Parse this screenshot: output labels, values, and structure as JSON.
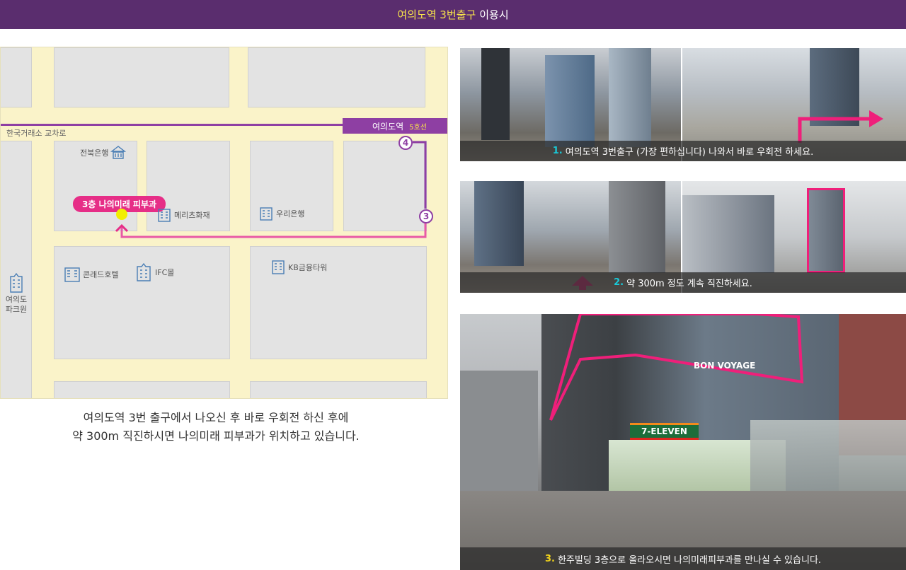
{
  "header": {
    "highlight": "여의도역 3번출구",
    "rest": "이용시"
  },
  "map": {
    "road": "한국거래소 교차로",
    "station_name": "여의도역",
    "station_line": "5호선",
    "exit_4": "4",
    "exit_3": "3",
    "clinic": "3층 나의미래 피부과",
    "places": {
      "jeonbuk": "전북은행",
      "meritz": "메리츠화재",
      "woori": "우리은행",
      "conrad": "콘래드호텔",
      "ifc": "IFC몰",
      "kb": "KB금융타워",
      "park_line1": "여의도",
      "park_line2": "파크원"
    }
  },
  "description": {
    "line1": "여의도역 3번 출구에서 나오신 후 바로 우회전 하신 후에",
    "line2": "약 300m 직진하시면 나의미래 피부과가 위치하고 있습니다."
  },
  "steps": [
    {
      "num": "1.",
      "text": "여의도역 3번출구 (가장 편하십니다) 나와서 바로 우회전 하세요."
    },
    {
      "num": "2.",
      "text": "약 300m 정도 계속 직진하세요."
    },
    {
      "num": "3.",
      "text": "한주빌딩 3층으로 올라오시면 나의미래피부과를 만나실 수 있습니다."
    }
  ],
  "photo3_signs": {
    "store": "7-ELEVEN",
    "voyage": "BON VOYAGE"
  },
  "colors": {
    "header_bg": "#5a2d6e",
    "highlight": "#f7e34a",
    "station": "#8e3fa3",
    "route": "#e85aa6",
    "clinic": "#e62e87",
    "step_num": "#19c9d8",
    "map_bg": "#faf3c9"
  }
}
